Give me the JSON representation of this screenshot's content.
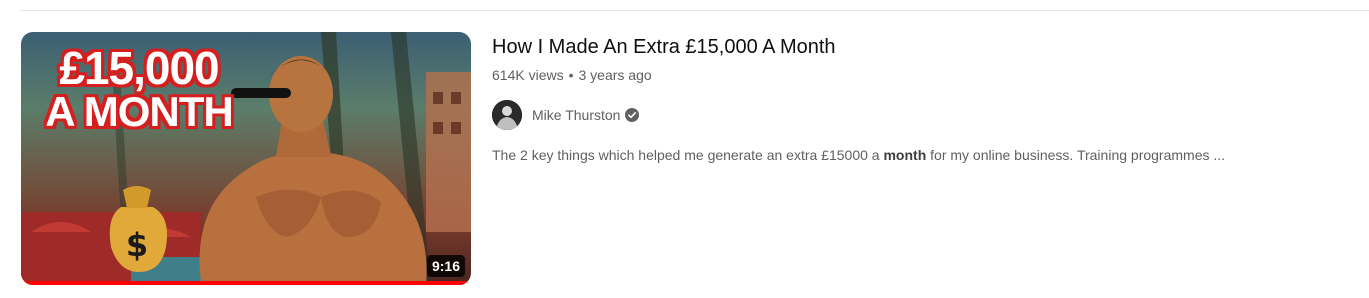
{
  "video": {
    "thumbnail": {
      "line1": "£15,000",
      "line2": "A MONTH",
      "duration": "9:16",
      "watch_progress": 1.0
    },
    "title": "How I Made An Extra £15,000 A Month",
    "views": "614K views",
    "separator": "•",
    "age": "3 years ago",
    "channel": {
      "name": "Mike Thurston",
      "verified_icon": "verified-check-icon"
    },
    "description": {
      "before": "The 2 key things which helped me generate an extra £15000 a ",
      "highlight": "month",
      "after": " for my online business. Training programmes ..."
    }
  },
  "colors": {
    "progress": "#ff0000",
    "thumb_text_outline": "#d51f1f",
    "meta_text": "#606060"
  }
}
